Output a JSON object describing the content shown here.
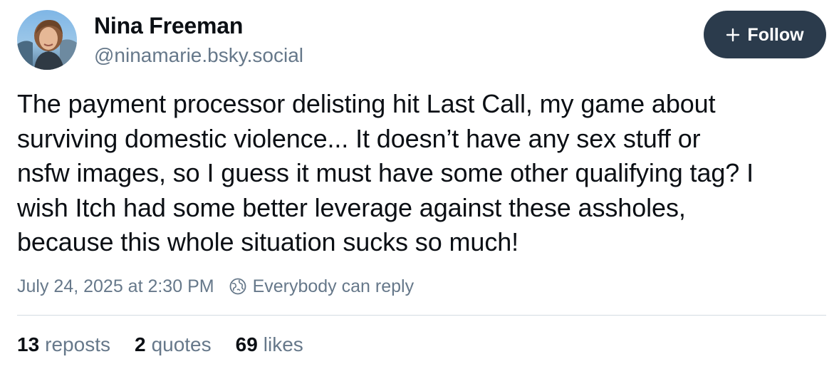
{
  "author": {
    "display_name": "Nina Freeman",
    "handle": "@ninamarie.bsky.social",
    "avatar_icon": "profile-photo"
  },
  "follow_button": {
    "label": "Follow",
    "icon": "plus-icon",
    "background": "#2b3b4c"
  },
  "post": {
    "text": "The payment processor delisting hit Last Call, my game about\nsurviving domestic violence... It doesn’t have any sex stuff or\nnsfw images, so I guess it must have some other qualifying tag? I\nwish Itch had some better leverage against these assholes,\nbecause this whole situation sucks so much!",
    "timestamp": "July 24, 2025 at 2:30 PM",
    "reply_setting": "Everybody can reply",
    "reply_icon": "globe-icon"
  },
  "stats": {
    "reposts": {
      "count": "13",
      "label": "reposts"
    },
    "quotes": {
      "count": "2",
      "label": "quotes"
    },
    "likes": {
      "count": "69",
      "label": "likes"
    }
  },
  "colors": {
    "text_primary": "#0b0f14",
    "text_secondary": "#66788a",
    "divider": "#d4dbe2"
  }
}
